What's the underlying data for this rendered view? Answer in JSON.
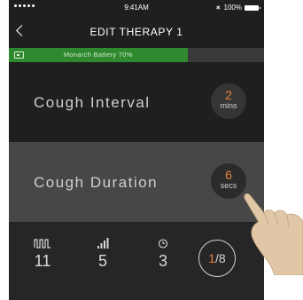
{
  "status_bar": {
    "time": "9:41AM",
    "battery": "100%"
  },
  "nav": {
    "title": "EDIT THERAPY 1"
  },
  "battery_banner": {
    "text": "Monarch Battery 70%",
    "level": 0.7
  },
  "rows": [
    {
      "label": "Cough Interval",
      "value": "2",
      "unit": "mins"
    },
    {
      "label": "Cough Duration",
      "value": "6",
      "unit": "secs"
    }
  ],
  "bottom": {
    "stats": [
      {
        "icon": "waveform-icon",
        "value": "11"
      },
      {
        "icon": "signal-bars-icon",
        "value": "5"
      },
      {
        "icon": "timer-icon",
        "value": "3"
      }
    ],
    "page_current": "1",
    "page_total": "/8"
  },
  "colors": {
    "accent": "#e8813a",
    "battery_green": "#2f8a2f",
    "background": "#1f1f1f",
    "selected_row": "#474747"
  }
}
